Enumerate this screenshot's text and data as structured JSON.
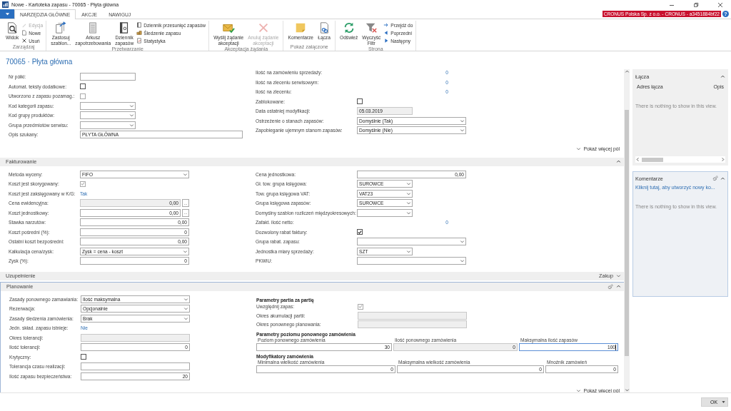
{
  "window": {
    "title": "Nowe - Kartoteka zapasu - 70065 · Płyta główna"
  },
  "menu_tabs": [
    {
      "label": "NARZĘDZIA GŁÓWNE",
      "selected": true
    },
    {
      "label": "AKCJE",
      "selected": false
    },
    {
      "label": "NAWIGUJ",
      "selected": false
    }
  ],
  "company": "CRONUS Polska Sp. z o.o. - CRONUS - a3451884bf22",
  "help_button": "?",
  "ribbon": [
    {
      "title": "Zarządzaj",
      "buttons": [
        {
          "label": "Widok",
          "kind": "large",
          "disabled": false
        },
        {
          "label": "Edycja",
          "kind": "small",
          "disabled": true
        },
        {
          "label": "Nowe",
          "kind": "small",
          "disabled": false
        },
        {
          "label": "Usuń",
          "kind": "small",
          "disabled": false
        }
      ]
    },
    {
      "title": "Przetwarzanie",
      "buttons": [
        {
          "label": "Zastosuj\nszablon...",
          "kind": "large",
          "disabled": false
        },
        {
          "label": "Arkusz\nzapotrzebowania",
          "kind": "large",
          "disabled": false
        },
        {
          "label": "Dziennik\nzapasów",
          "kind": "large",
          "disabled": false
        },
        {
          "label": "Dziennik przesunięć zapasów",
          "kind": "small",
          "disabled": false
        },
        {
          "label": "Śledzenie zapasu",
          "kind": "small",
          "disabled": false
        },
        {
          "label": "Statystyka",
          "kind": "small",
          "disabled": false
        }
      ]
    },
    {
      "title": "Akceptacja żądania",
      "buttons": [
        {
          "label": "Wyślij żądanie\nakceptacji",
          "kind": "large",
          "disabled": false
        },
        {
          "label": "Anuluj żądanie\nakceptacji",
          "kind": "large",
          "disabled": true
        }
      ]
    },
    {
      "title": "Pokaż załączone",
      "buttons": [
        {
          "label": "Komentarze",
          "kind": "large",
          "disabled": false
        },
        {
          "label": "Łącza",
          "kind": "large",
          "disabled": false
        }
      ]
    },
    {
      "title": "Strona",
      "buttons": [
        {
          "label": "Odśwież",
          "kind": "large",
          "disabled": false
        },
        {
          "label": "Wyczyść\nFiltr",
          "kind": "large",
          "disabled": false
        },
        {
          "label": "Przejdź do",
          "kind": "small",
          "disabled": false
        },
        {
          "label": "Poprzedni",
          "kind": "small",
          "disabled": false
        },
        {
          "label": "Następny",
          "kind": "small",
          "disabled": false
        }
      ]
    }
  ],
  "page_title": "70065 · Płyta główna",
  "general": {
    "left": [
      {
        "label": "Nr półki:",
        "kind": "text-short"
      },
      {
        "label": "Automat. teksty dodatkowe:",
        "kind": "check",
        "checked": false,
        "disabled": false
      },
      {
        "label": "Utworzono z zapasu pozamag.:",
        "kind": "check",
        "checked": false,
        "disabled": true
      },
      {
        "label": "Kod kategorii zapasu:",
        "kind": "select-short"
      },
      {
        "label": "Kod grupy produktów:",
        "kind": "select-short"
      },
      {
        "label": "Grupa przedmiotów serwisu:",
        "kind": "select-short"
      },
      {
        "label": "Opis szukany:",
        "kind": "text-long",
        "value": "PŁYTA GŁÓWNA"
      }
    ],
    "right": [
      {
        "label": "Ilość na zamówieniu sprzedaży:",
        "kind": "flow",
        "value": "0"
      },
      {
        "label": "Ilość na zleceniu serwisowym:",
        "kind": "flow",
        "value": "0"
      },
      {
        "label": "Ilość na zleceniu:",
        "kind": "flow",
        "value": "0"
      },
      {
        "label": "Zablokowane:",
        "kind": "check",
        "checked": false,
        "disabled": false
      },
      {
        "label": "Data ostatniej modyfikacji:",
        "kind": "readonly-short",
        "value": "05.03.2019"
      },
      {
        "label": "Ostrzeżenie o stanach zapasów:",
        "kind": "select",
        "value": "Domyślnie (Tak)"
      },
      {
        "label": "Zapobieganie ujemnym stanom zapasów:",
        "kind": "select",
        "value": "Domyślnie (Nie)"
      }
    ],
    "more_link": "Pokaż więcej pól"
  },
  "sections": [
    {
      "title": "Fakturowanie",
      "expanded": true,
      "selected": false,
      "left": [
        {
          "label": "Metoda wyceny:",
          "kind": "select",
          "value": "FIFO"
        },
        {
          "label": "Koszt jest skorygowany:",
          "kind": "check",
          "checked": true,
          "disabled": true
        },
        {
          "label": "Koszt jest zaksięgowany w K/G:",
          "kind": "link",
          "value": "Tak"
        },
        {
          "label": "Cena ewidencyjna:",
          "kind": "readonly-number",
          "value": "0,00",
          "assist_button": "..."
        },
        {
          "label": "Koszt jednostkowy:",
          "kind": "number",
          "value": "0,00",
          "assist_button": "..."
        },
        {
          "label": "Stawka narzutów:",
          "kind": "number",
          "value": "0,00"
        },
        {
          "label": "Koszt pośredni (%):",
          "kind": "number",
          "value": "0"
        },
        {
          "label": "Ostatni koszt bezpośredni:",
          "kind": "number",
          "value": "0,00"
        },
        {
          "label": "Kalkulacja cena/zysk:",
          "kind": "select",
          "value": "Zysk = cena - koszt"
        },
        {
          "label": "Zysk (%):",
          "kind": "number",
          "value": "0"
        }
      ],
      "right": [
        {
          "label": "Cena jednostkowa:",
          "kind": "number",
          "value": "0,00"
        },
        {
          "label": "Gł. tow. grupa księgowa:",
          "kind": "select-short",
          "value": "SUROWCE"
        },
        {
          "label": "Tow. grupa księgowa VAT:",
          "kind": "select-short",
          "value": "VAT23"
        },
        {
          "label": "Grupa księgowa zapasów:",
          "kind": "select-short",
          "value": "SUROWCE"
        },
        {
          "label": "Domyślny szablon rozliczeń międzyokresowych:",
          "kind": "select-short"
        },
        {
          "label": "Zafakt. ilość netto:",
          "kind": "flow",
          "value": "0"
        },
        {
          "label": "Dozwolony rabat faktury:",
          "kind": "check",
          "checked": true,
          "disabled": false
        },
        {
          "label": "Grupa rabat. zapasu:",
          "kind": "select"
        },
        {
          "label": "Jednostka miary sprzedaży:",
          "kind": "select-short",
          "value": "SZT"
        },
        {
          "label": "PKWiU:",
          "kind": "select"
        }
      ]
    },
    {
      "title": "Uzupełnienie",
      "expanded": false,
      "selected": false,
      "summary": "Zakup"
    },
    {
      "title": "Planowanie",
      "expanded": true,
      "selected": true,
      "left": [
        {
          "label": "Zasady ponownego zamawiania:",
          "kind": "select",
          "value": "Ilość maksymalna"
        },
        {
          "label": "Rezerwacja:",
          "kind": "select",
          "value": "Opcjonalnie"
        },
        {
          "label": "Zasady śledzenia zamówienia:",
          "kind": "select",
          "value": "Brak"
        },
        {
          "label": "Jedn. skład. zapasu istnieje:",
          "kind": "link",
          "value": "Nie"
        },
        {
          "label": "Okres tolerancji:",
          "kind": "readonly"
        },
        {
          "label": "Ilość tolerancji:",
          "kind": "number",
          "value": "0"
        },
        {
          "label": "Krytyczny:",
          "kind": "check",
          "checked": false,
          "disabled": false
        },
        {
          "label": "Tolerancja czasu realizacji:",
          "kind": "text"
        },
        {
          "label": "Ilość zapasu bezpieczeństwa:",
          "kind": "number",
          "value": "20"
        }
      ],
      "right": [
        {
          "kind": "heading",
          "label": "Parametry partia za partię"
        },
        {
          "label": "Uwzględnij zapas:",
          "kind": "check",
          "checked": true,
          "disabled": true
        },
        {
          "label": "Okres akumulacji partii:",
          "kind": "readonly"
        },
        {
          "label": "Okres ponownego planowania:",
          "kind": "readonly"
        },
        {
          "kind": "heading",
          "label": "Parametry poziomu ponownego zamówienia"
        },
        {
          "kind": "grid",
          "fields": [
            {
              "label": "Poziom ponownego zamówienia",
              "value": "30",
              "readonly": false,
              "focused": false
            },
            {
              "label": "Ilość ponownego zamówienia",
              "value": "0",
              "readonly": true,
              "focused": false
            },
            {
              "label": "Maksymalna ilość zapasów",
              "value": "100",
              "readonly": false,
              "focused": true
            }
          ]
        },
        {
          "kind": "heading",
          "label": "Modyfikatory zamówienia"
        },
        {
          "kind": "grid",
          "fields": [
            {
              "label": "Minimalna wielkość zamówienia",
              "value": "0",
              "readonly": false,
              "focused": false
            },
            {
              "label": "Maksymalna wielkość zamówienia",
              "value": "0",
              "readonly": false,
              "focused": false
            },
            {
              "label": "Mnożnik zamówień",
              "value": "0",
              "readonly": false,
              "focused": false
            }
          ]
        }
      ],
      "more_link": "Pokaż więcej pól"
    }
  ],
  "factboxes": [
    {
      "title": "Łącza",
      "selected": false,
      "columns": [
        "Adres łącza",
        "Opis"
      ],
      "empty_text": "There is nothing to show in this view."
    },
    {
      "title": "Komentarze",
      "selected": true,
      "link": "Kliknij tutaj, aby utworzyć nowy ko...",
      "empty_text": "There is nothing to show in this view."
    }
  ],
  "ok_button": "OK"
}
